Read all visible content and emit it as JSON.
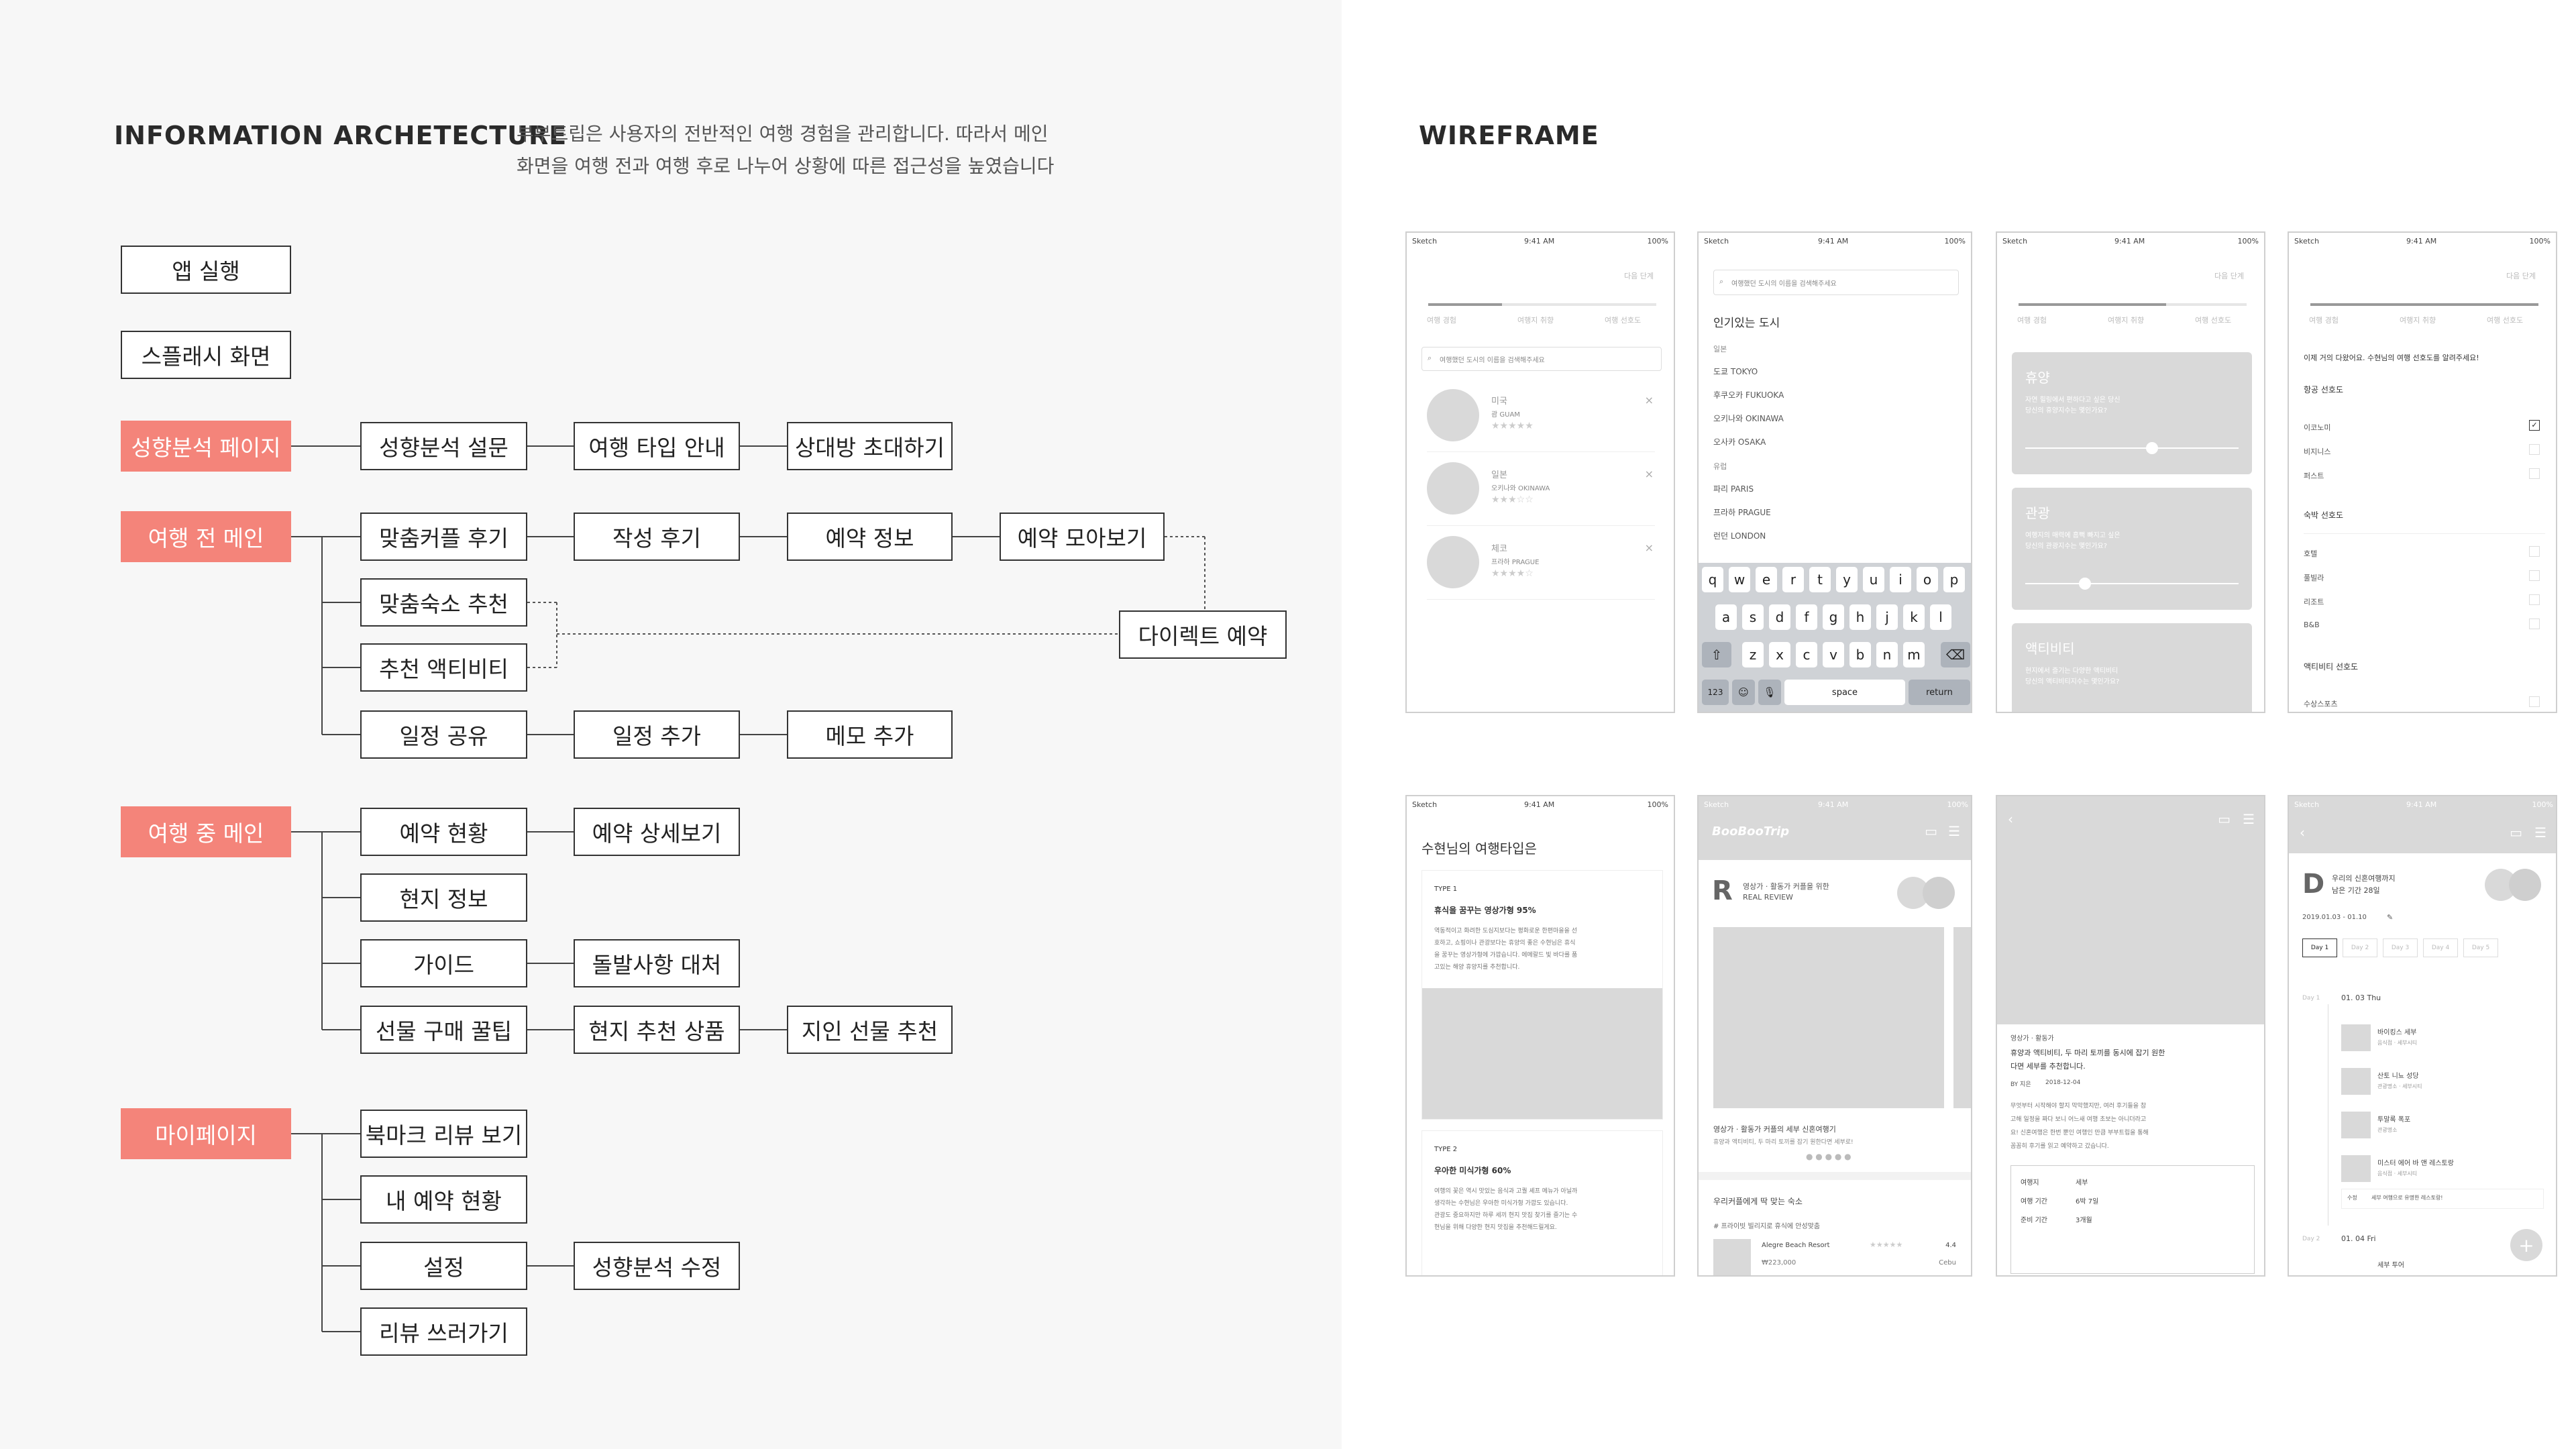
{
  "ia": {
    "heading": "INFORMATION ARCHETECTURE",
    "desc_line1": "부부트립은 사용자의 전반적인 여행 경험을 관리합니다. 따라서 메인",
    "desc_line2": "화면을 여행 전과 여행 후로 나누어 상황에 따른 접근성을 높였습니다",
    "app_launch": "앱 실행",
    "splash": "스플래시 화면",
    "sections": {
      "personality": "성향분석 페이지",
      "pre_trip": "여행 전 메인",
      "during_trip": "여행 중 메인",
      "mypage": "마이페이지"
    },
    "nodes": {
      "survey": "성향분석 설문",
      "trip_type": "여행 타입 안내",
      "invite": "상대방 초대하기",
      "couple_review": "맞춤커플 후기",
      "write_review": "작성 후기",
      "booking_info": "예약 정보",
      "booking_all": "예약 모아보기",
      "stay_rec": "맞춤숙소 추천",
      "activity_rec": "추천 액티비티",
      "direct_booking": "다이렉트 예약",
      "share_schedule": "일정 공유",
      "add_schedule": "일정 추가",
      "add_memo": "메모 추가",
      "booking_status": "예약 현황",
      "booking_detail": "예약 상세보기",
      "local_info": "현지 정보",
      "guide": "가이드",
      "emergency": "돌발사항 대처",
      "gift_tips": "선물 구매 꿀팁",
      "local_products": "현지 추천 상품",
      "friend_gift": "지인 선물 추천",
      "bookmark_review": "북마크 리뷰 보기",
      "my_booking": "내 예약 현황",
      "settings": "설정",
      "edit_personality": "성향분석 수정",
      "write_review2": "리뷰 쓰러가기"
    }
  },
  "wireframe": {
    "heading": "WIREFRAME",
    "status_left": "Sketch",
    "status_time": "9:41 AM",
    "status_right": "100%",
    "next_step": "다음 단계",
    "search_placeholder": "여행했던 도시의 이름을 검색해주세요",
    "step_labels": [
      "여행 경험",
      "여행지 취향",
      "여행 선호도"
    ],
    "p1_items": [
      {
        "title": "미국",
        "sub": "괌 GUAM"
      },
      {
        "title": "일본",
        "sub": "오키나와 OKINAWA"
      },
      {
        "title": "체코",
        "sub": "프라하 PRAGUE"
      }
    ],
    "p2_title": "인기있는 도시",
    "p2_group": "일본",
    "p2_cities": [
      "도쿄 TOKYO",
      "후쿠오카 FUKUOKA",
      "오키나와 OKINAWA",
      "오사카 OSAKA"
    ],
    "p2_group2": "유럽",
    "p2_cities2": [
      "파리 PARIS",
      "프라하 PRAGUE",
      "런던 LONDON"
    ],
    "keyboard_row1": [
      "q",
      "w",
      "e",
      "r",
      "t",
      "y",
      "u",
      "i",
      "o",
      "p"
    ],
    "keyboard_row2": [
      "a",
      "s",
      "d",
      "f",
      "g",
      "h",
      "j",
      "k",
      "l"
    ],
    "keyboard_row3": [
      "z",
      "x",
      "c",
      "v",
      "b",
      "n",
      "m"
    ],
    "kb_123": "123",
    "kb_space": "space",
    "kb_return": "return",
    "p3_cards": [
      {
        "title": "휴양",
        "sub1": "자연 힐링에서 편하다고 싶은 당신",
        "sub2": "당신의 휴양지수는 몇인가요?"
      },
      {
        "title": "관광",
        "sub1": "여행지의 매력에 흠뻑 빠지고 싶은",
        "sub2": "당신의 관광지수는 몇인가요?"
      },
      {
        "title": "액티비티",
        "sub1": "현지에서 즐기는 다양한 액티비티",
        "sub2": "당신의 액티비티지수는 몇인가요?"
      }
    ],
    "p4_question": "이제 거의 다왔어요. 수현님의 여행 선호도를 알려주세요!",
    "p4_air": "항공 선호도",
    "p4_air_items": [
      "이코노미",
      "비지니스",
      "퍼스트"
    ],
    "p4_stay": "숙박 선호도",
    "p4_stay_items": [
      "호텔",
      "풀빌라",
      "리조트",
      "B&B"
    ],
    "p4_activity": "액티비티 선호도",
    "p4_activity_items": [
      "수상스포츠"
    ],
    "p5_title": "수현님의 여행타입은",
    "p5_type1": "TYPE 1",
    "p5_type1_title": "휴식을 꿈꾸는 영상가형 95%",
    "p5_type1_body": [
      "역동적이고 화려한 도심지보다는 평화로운 한편마을을 선",
      "호하고, 쇼핑이나 관광보다는 휴양의 좋은 수현님은 휴식",
      "을 꿈꾸는 영상가형에 가깝습니다. 에메랄드 빛 바다를 품",
      "고있는 해양 휴양지를 추천합니다."
    ],
    "p5_type2": "TYPE 2",
    "p5_type2_title": "우아한 미식가형 60%",
    "p5_type2_body": [
      "여행의 꽃은 역시 맛있는 음식과 고퀄 셰프 메뉴가 아닐까",
      "생각하는 수현님은 우아한 미식가형 가깝도 있습니다.",
      "관광도 중요하지만 하루 세끼 현지 맛집 찾기를 즐기는 수",
      "현님을 위해 다양한 현지 맛집을 추천해드릴게요."
    ],
    "p6_brand": "BooBooTrip",
    "p6_review_line1": "영상가 · 활동가 커플을 위한",
    "p6_review_line2": "REAL REVIEW",
    "p6_caption": "영상가 · 활동가 커플의 세부 신혼여행기",
    "p6_caption_sub": "휴양과 액티비티, 두 마리 토끼를 잡기 원한다면 세부로!",
    "p6_section": "우리커플에게 딱 맞는 숙소",
    "p6_tag": "# 프라이빗 빌리지로 휴식에 안성맞춤",
    "p6_hotel": "Alegre Beach Resort",
    "p6_rating": "4.4",
    "p6_price": "₩223,000",
    "p6_city": "Cebu",
    "p7_tag": "영상가 · 활동가",
    "p7_title_line1": "휴양과 액티비티, 두 마리 토끼를 동시에 잡기 원한",
    "p7_title_line2": "다면 세부를 추천합니다.",
    "p7_by": "BY 지은",
    "p7_date": "2018-12-04",
    "p7_body": [
      "무엇부터 시작해야 할지 막막했지만, 여러 후기들을 참",
      "고해 일정을 짜다 보니 어느새 여행 초보는 아니더라고",
      "요! 신혼여행은 한번 뿐인 여행인 만큼 부부트립을 통해",
      "꼼꼼히 후기를 읽고 예약하고 갔습니다."
    ],
    "p7_info": [
      [
        "여행지",
        "세부"
      ],
      [
        "여행 기간",
        "6박 7일"
      ],
      [
        "준비 기간",
        "3개월"
      ]
    ],
    "p8_dday_line1": "우리의 신혼여행까지",
    "p8_dday_line2": "남은 기간 28일",
    "p8_dates": "2019.01.03 - 01.10",
    "p8_days": [
      "Day 1",
      "Day 2",
      "Day 3",
      "Day 4",
      "Day 5"
    ],
    "p8_day1_label": "Day 1",
    "p8_day1_date": "01. 03 Thu",
    "p8_items": [
      {
        "title": "바이킹스 세부",
        "sub": "음식점 · 세부시티"
      },
      {
        "title": "산토 니뇨 성당",
        "sub": "관광명소 · 세부시티"
      },
      {
        "title": "투말록 폭포",
        "sub": "관광명소"
      },
      {
        "title": "미스터 에어 바 앤 레스토랑",
        "sub": "음식점 · 세부시티"
      }
    ],
    "p8_memo_label": "수정",
    "p8_memo": "세부 여행으로 유명한 레스토랑!",
    "p8_day2_label": "Day 2",
    "p8_day2_date": "01. 04 Fri",
    "p8_day2_item": "세부 투어"
  }
}
